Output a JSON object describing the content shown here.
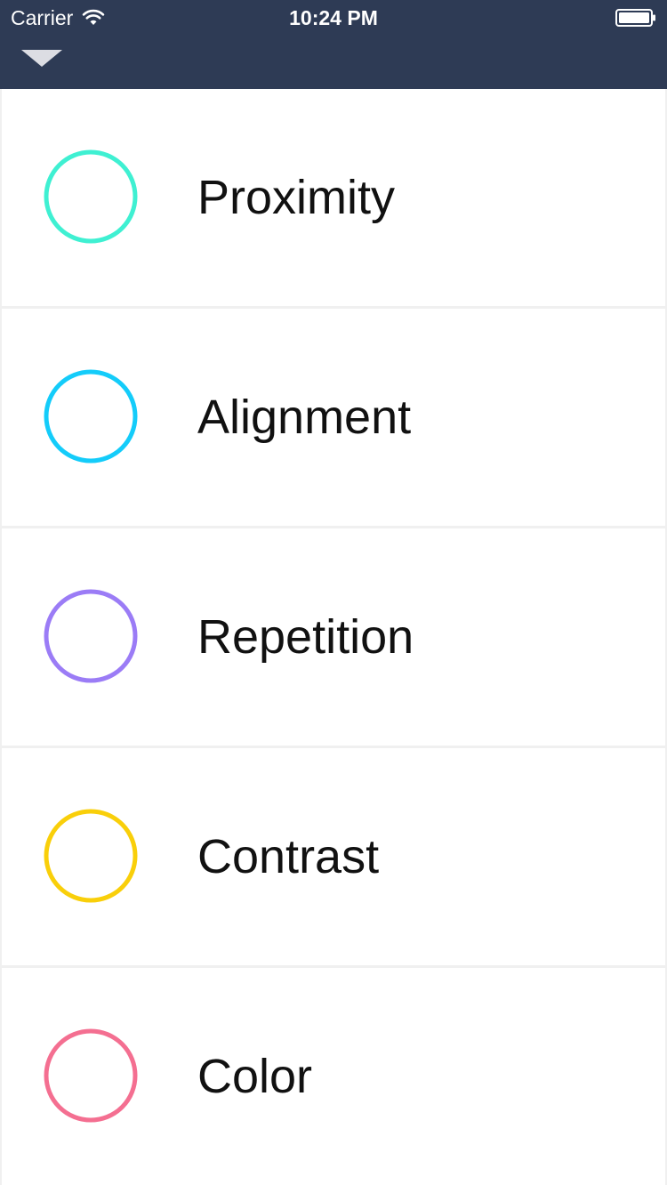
{
  "status_bar": {
    "carrier": "Carrier",
    "time": "10:24 PM",
    "wifi_icon": "wifi-icon",
    "battery_icon": "battery-icon"
  },
  "header": {
    "collapse_icon": "chevron-down-icon",
    "background_color": "#2e3b55"
  },
  "items": [
    {
      "label": "Proximity",
      "color": "#3ff0d2",
      "icon": "circle-outline-icon"
    },
    {
      "label": "Alignment",
      "color": "#14ccfa",
      "icon": "circle-outline-icon"
    },
    {
      "label": "Repetition",
      "color": "#9b7cf6",
      "icon": "circle-outline-icon"
    },
    {
      "label": "Contrast",
      "color": "#f9cf0a",
      "icon": "circle-outline-icon"
    },
    {
      "label": "Color",
      "color": "#f46f91",
      "icon": "circle-outline-icon"
    }
  ]
}
